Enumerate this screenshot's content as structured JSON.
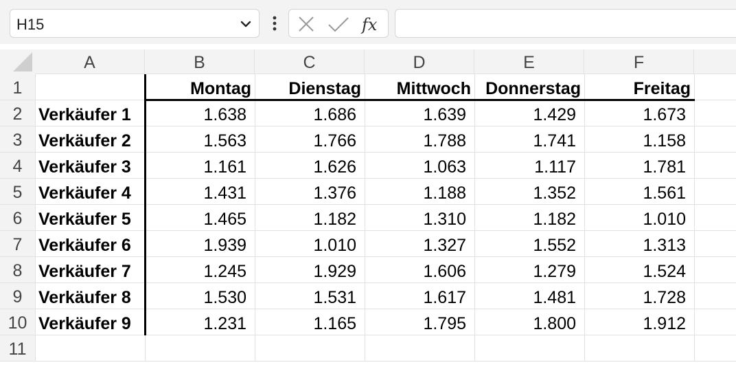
{
  "formula_bar": {
    "name_box": "H15",
    "formula": ""
  },
  "grid": {
    "columns": [
      "A",
      "B",
      "C",
      "D",
      "E",
      "F"
    ],
    "rows": [
      "1",
      "2",
      "3",
      "4",
      "5",
      "6",
      "7",
      "8",
      "9",
      "10",
      "11"
    ],
    "header_row": [
      "",
      "Montag",
      "Dienstag",
      "Mittwoch",
      "Donnerstag",
      "Freitag"
    ],
    "data_rows": [
      [
        "Verkäufer 1",
        "1.638",
        "1.686",
        "1.639",
        "1.429",
        "1.673"
      ],
      [
        "Verkäufer 2",
        "1.563",
        "1.766",
        "1.788",
        "1.741",
        "1.158"
      ],
      [
        "Verkäufer 3",
        "1.161",
        "1.626",
        "1.063",
        "1.117",
        "1.781"
      ],
      [
        "Verkäufer 4",
        "1.431",
        "1.376",
        "1.188",
        "1.352",
        "1.561"
      ],
      [
        "Verkäufer 5",
        "1.465",
        "1.182",
        "1.310",
        "1.182",
        "1.010"
      ],
      [
        "Verkäufer 6",
        "1.939",
        "1.010",
        "1.327",
        "1.552",
        "1.313"
      ],
      [
        "Verkäufer 7",
        "1.245",
        "1.929",
        "1.606",
        "1.279",
        "1.524"
      ],
      [
        "Verkäufer 8",
        "1.530",
        "1.531",
        "1.617",
        "1.481",
        "1.728"
      ],
      [
        "Verkäufer 9",
        "1.231",
        "1.165",
        "1.795",
        "1.800",
        "1.912"
      ]
    ]
  },
  "icons": {
    "chevron": "chevron-down-icon",
    "more": "more-vertical-icon",
    "cancel": "cancel-x-icon",
    "enter": "enter-check-icon",
    "function": "insert-function-icon"
  }
}
